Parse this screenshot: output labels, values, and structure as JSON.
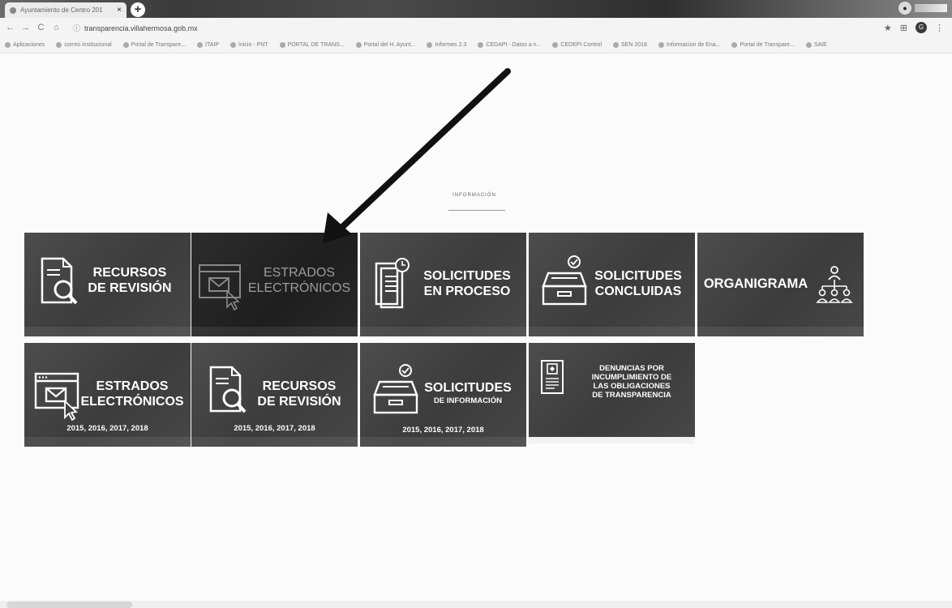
{
  "browser": {
    "tab_title": "Ayuntamiento de Centro 201",
    "tab_close": "×",
    "new_tab": "+",
    "url": "transparencia.villahermosa.gob.mx",
    "bookmarks": [
      "Aplicaciones",
      "correo institucional",
      "Portal de Transpare...",
      "ITAIP",
      "Inicio - PNT",
      "PORTAL DE TRANS...",
      "Portal del H. Ayunt...",
      "Informes 2.3",
      "CEDAPI - Datos a n...",
      "CEDEPI Control",
      "SEN 2018",
      "Informacion de Ena...",
      "Portal de Transpare...",
      "SAIE"
    ]
  },
  "section": {
    "label": "INFORMACIÓN"
  },
  "tiles": [
    {
      "line1": "RECURSOS",
      "line2": "DE REVISIÓN",
      "icon": "document-search-icon"
    },
    {
      "line1": "ESTRADOS",
      "line2": "ELECTRÓNICOS",
      "icon": "envelope-window-icon"
    },
    {
      "line1": "SOLICITUDES",
      "line2": "EN PROCESO",
      "icon": "documents-clock-icon"
    },
    {
      "line1": "SOLICITUDES",
      "line2": "CONCLUIDAS",
      "icon": "archive-box-check-icon"
    },
    {
      "line1": "ORGANIGRAMA",
      "icon": "org-chart-people-icon"
    },
    {
      "line1": "ESTRADOS",
      "line2": "ELECTRÓNICOS",
      "years": "2015, 2016, 2017, 2018",
      "icon": "envelope-window-icon"
    },
    {
      "line1": "RECURSOS",
      "line2": "DE REVISIÓN",
      "years": "2015, 2016, 2017, 2018",
      "icon": "document-search-icon"
    },
    {
      "line1": "SOLICITUDES",
      "line2": "DE INFORMACIÓN",
      "years": "2015, 2016, 2017, 2018",
      "icon": "archive-box-check-icon"
    },
    {
      "lines": [
        "DENUNCIAS POR",
        "INCUMPLIMIENTO DE",
        "LAS OBLIGACIONES",
        "DE TRANSPARENCIA"
      ],
      "icon": "certificate-document-icon"
    }
  ]
}
